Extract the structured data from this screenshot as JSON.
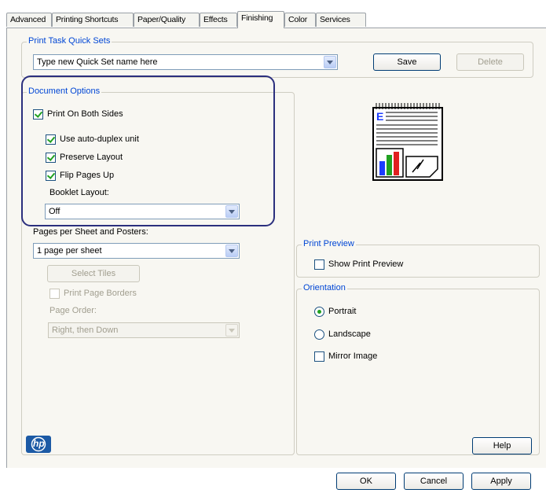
{
  "tabs": [
    {
      "label": "Advanced"
    },
    {
      "label": "Printing Shortcuts"
    },
    {
      "label": "Paper/Quality"
    },
    {
      "label": "Effects"
    },
    {
      "label": "Finishing"
    },
    {
      "label": "Color"
    },
    {
      "label": "Services"
    }
  ],
  "active_tab": "Finishing",
  "quick_sets": {
    "legend": "Print Task Quick Sets",
    "value": "Type new Quick Set name here",
    "save_label": "Save",
    "delete_label": "Delete"
  },
  "document_options": {
    "legend": "Document Options",
    "print_both_sides": {
      "label": "Print On Both Sides",
      "checked": true
    },
    "auto_duplex": {
      "label": "Use auto-duplex unit",
      "checked": true
    },
    "preserve_layout": {
      "label": "Preserve Layout",
      "checked": true
    },
    "flip_pages": {
      "label": "Flip Pages Up",
      "checked": true
    },
    "booklet_label": "Booklet Layout:",
    "booklet_value": "Off",
    "pages_per_sheet_label": "Pages per Sheet and Posters:",
    "pages_per_sheet_value": "1 page per sheet",
    "select_tiles_label": "Select Tiles",
    "print_page_borders": {
      "label": "Print Page Borders",
      "checked": false
    },
    "page_order_label": "Page Order:",
    "page_order_value": "Right, then Down"
  },
  "preview_icon": "document-preview-icon",
  "print_preview": {
    "legend": "Print Preview",
    "show_label": "Show Print Preview",
    "checked": false
  },
  "orientation": {
    "legend": "Orientation",
    "portrait_label": "Portrait",
    "landscape_label": "Landscape",
    "mirror_label": "Mirror Image",
    "selected": "Portrait",
    "mirror_checked": false
  },
  "footer": {
    "logo_text": "hp",
    "help_label": "Help",
    "ok_label": "OK",
    "cancel_label": "Cancel",
    "apply_label": "Apply"
  },
  "colors": {
    "legend_blue": "#0046d5",
    "check_green": "#21a121",
    "highlight_ring": "#2b2f7e",
    "hp_blue": "#1c5aa5"
  }
}
